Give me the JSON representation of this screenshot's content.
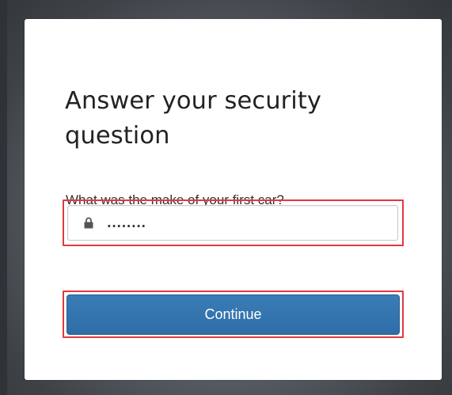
{
  "card": {
    "title": "Answer your security question",
    "question": "What was the make of your first car?"
  },
  "answer_field": {
    "value": "........",
    "icon": "lock-icon"
  },
  "continue_button": {
    "label": "Continue"
  },
  "colors": {
    "button_blue": "#3174ae",
    "highlight_red": "#e0393e"
  }
}
